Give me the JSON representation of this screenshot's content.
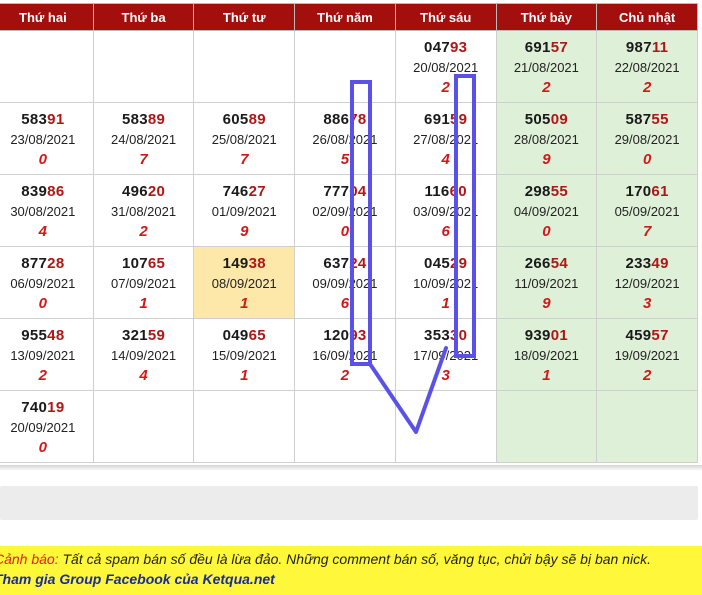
{
  "headers": [
    "Thứ hai",
    "Thứ ba",
    "Thứ tư",
    "Thứ năm",
    "Thứ sáu",
    "Thứ bảy",
    "Chủ nhật"
  ],
  "rows": [
    [
      null,
      null,
      null,
      null,
      {
        "head": "047",
        "tail": "93",
        "date": "20/08/2021",
        "digit": "2"
      },
      {
        "head": "691",
        "tail": "57",
        "date": "21/08/2021",
        "digit": "2"
      },
      {
        "head": "987",
        "tail": "11",
        "date": "22/08/2021",
        "digit": "2"
      }
    ],
    [
      {
        "head": "583",
        "tail": "91",
        "date": "23/08/2021",
        "digit": "0"
      },
      {
        "head": "583",
        "tail": "89",
        "date": "24/08/2021",
        "digit": "7"
      },
      {
        "head": "605",
        "tail": "89",
        "date": "25/08/2021",
        "digit": "7"
      },
      {
        "head": "886",
        "tail": "78",
        "date": "26/08/2021",
        "digit": "5"
      },
      {
        "head": "691",
        "tail": "59",
        "date": "27/08/2021",
        "digit": "4"
      },
      {
        "head": "505",
        "tail": "09",
        "date": "28/08/2021",
        "digit": "9"
      },
      {
        "head": "587",
        "tail": "55",
        "date": "29/08/2021",
        "digit": "0"
      }
    ],
    [
      {
        "head": "839",
        "tail": "86",
        "date": "30/08/2021",
        "digit": "4"
      },
      {
        "head": "496",
        "tail": "20",
        "date": "31/08/2021",
        "digit": "2"
      },
      {
        "head": "746",
        "tail": "27",
        "date": "01/09/2021",
        "digit": "9"
      },
      {
        "head": "777",
        "tail": "04",
        "date": "02/09/2021",
        "digit": "0"
      },
      {
        "head": "116",
        "tail": "60",
        "date": "03/09/2021",
        "digit": "6"
      },
      {
        "head": "298",
        "tail": "55",
        "date": "04/09/2021",
        "digit": "0"
      },
      {
        "head": "170",
        "tail": "61",
        "date": "05/09/2021",
        "digit": "7"
      }
    ],
    [
      {
        "head": "877",
        "tail": "28",
        "date": "06/09/2021",
        "digit": "0"
      },
      {
        "head": "107",
        "tail": "65",
        "date": "07/09/2021",
        "digit": "1"
      },
      {
        "head": "149",
        "tail": "38",
        "date": "08/09/2021",
        "digit": "1",
        "highlight": true
      },
      {
        "head": "637",
        "tail": "24",
        "date": "09/09/2021",
        "digit": "6"
      },
      {
        "head": "045",
        "tail": "29",
        "date": "10/09/2021",
        "digit": "1"
      },
      {
        "head": "266",
        "tail": "54",
        "date": "11/09/2021",
        "digit": "9"
      },
      {
        "head": "233",
        "tail": "49",
        "date": "12/09/2021",
        "digit": "3"
      }
    ],
    [
      {
        "head": "955",
        "tail": "48",
        "date": "13/09/2021",
        "digit": "2"
      },
      {
        "head": "321",
        "tail": "59",
        "date": "14/09/2021",
        "digit": "4"
      },
      {
        "head": "049",
        "tail": "65",
        "date": "15/09/2021",
        "digit": "1"
      },
      {
        "head": "120",
        "tail": "93",
        "date": "16/09/2021",
        "digit": "2"
      },
      {
        "head": "353",
        "tail": "30",
        "date": "17/09/2021",
        "digit": "3"
      },
      {
        "head": "939",
        "tail": "01",
        "date": "18/09/2021",
        "digit": "1"
      },
      {
        "head": "459",
        "tail": "57",
        "date": "19/09/2021",
        "digit": "2"
      }
    ],
    [
      {
        "head": "740",
        "tail": "19",
        "date": "20/09/2021",
        "digit": "0"
      },
      null,
      null,
      null,
      null,
      null,
      null
    ]
  ],
  "notice": {
    "warning_label": "Cảnh báo:",
    "warning_text": " Tất cả spam bán số đều là lừa đảo. Những comment bán số, văng tục, chửi bậy sẽ bị ban nick.",
    "group_link": "Tham gia Group Facebook của Ketqua.net"
  },
  "colors": {
    "header_bg": "#a30f0c",
    "weekend_bg": "#dff0d8",
    "highlight_bg": "#fde7a9",
    "digit_red": "#d01818",
    "annotation_blue": "#5a52e8",
    "notice_bg": "#fff73a"
  }
}
